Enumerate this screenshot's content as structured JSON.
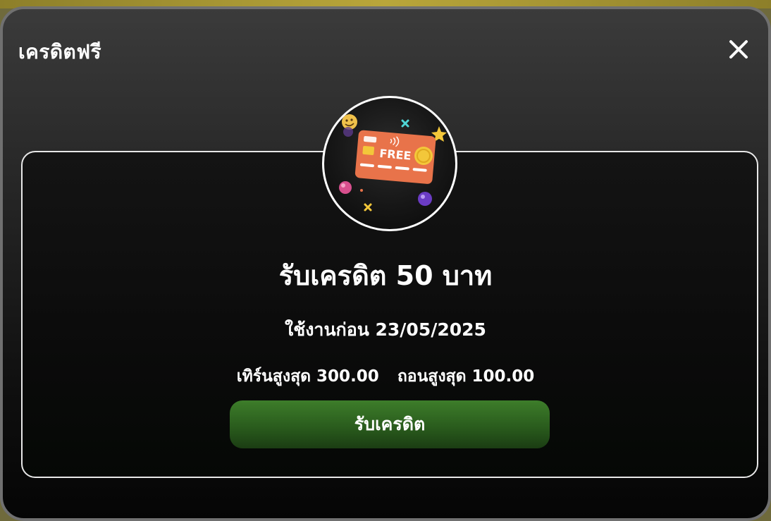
{
  "modal": {
    "title": "เครดิตฟรี",
    "close_icon": "close-icon"
  },
  "promo": {
    "illustration_icon": "free-credit-card-icon",
    "card_label": "FREE",
    "headline": "รับเครดิต 50 บาท",
    "expiry": "ใช้งานก่อน 23/05/2025",
    "max_turnover": "เทิร์นสูงสุด 300.00",
    "max_withdraw": "ถอนสูงสุด 100.00",
    "claim_button": "รับเครดิต"
  },
  "colors": {
    "modal_bg_top": "#3b3b3b",
    "modal_bg_bottom": "#050505",
    "button_green": "#2f6a22",
    "card_orange": "#e8734a",
    "text": "#ffffff"
  }
}
